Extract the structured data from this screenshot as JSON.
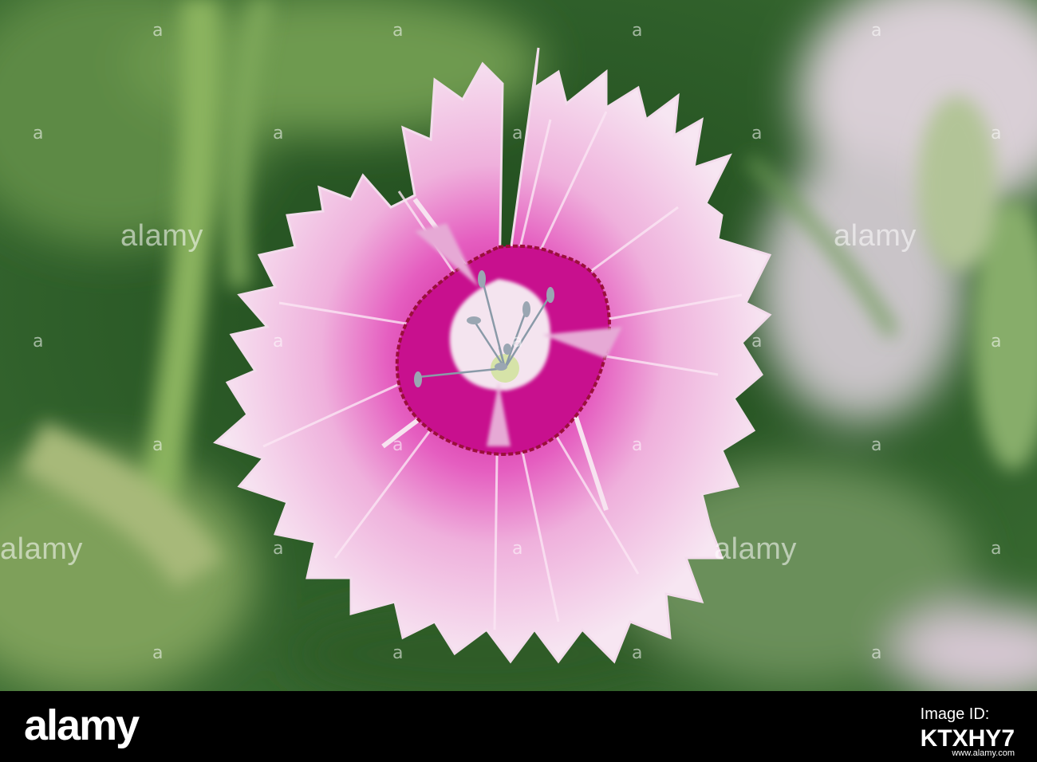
{
  "photo": {
    "subject": "pink-dianthus-flower",
    "colors": {
      "background": "#2b5a26",
      "petal_light": "#f4dcef",
      "petal_pink": "#e55ec0",
      "center_magenta": "#c8108e",
      "eye_ring": "#a8123a",
      "center_white": "#f7f1f4"
    }
  },
  "watermarks": {
    "word": "alamy",
    "glyph": "a"
  },
  "footer": {
    "logo_text": "alamy",
    "image_id_label": "Image ID:",
    "image_id": "KTXHY7",
    "url": "www.alamy.com"
  }
}
